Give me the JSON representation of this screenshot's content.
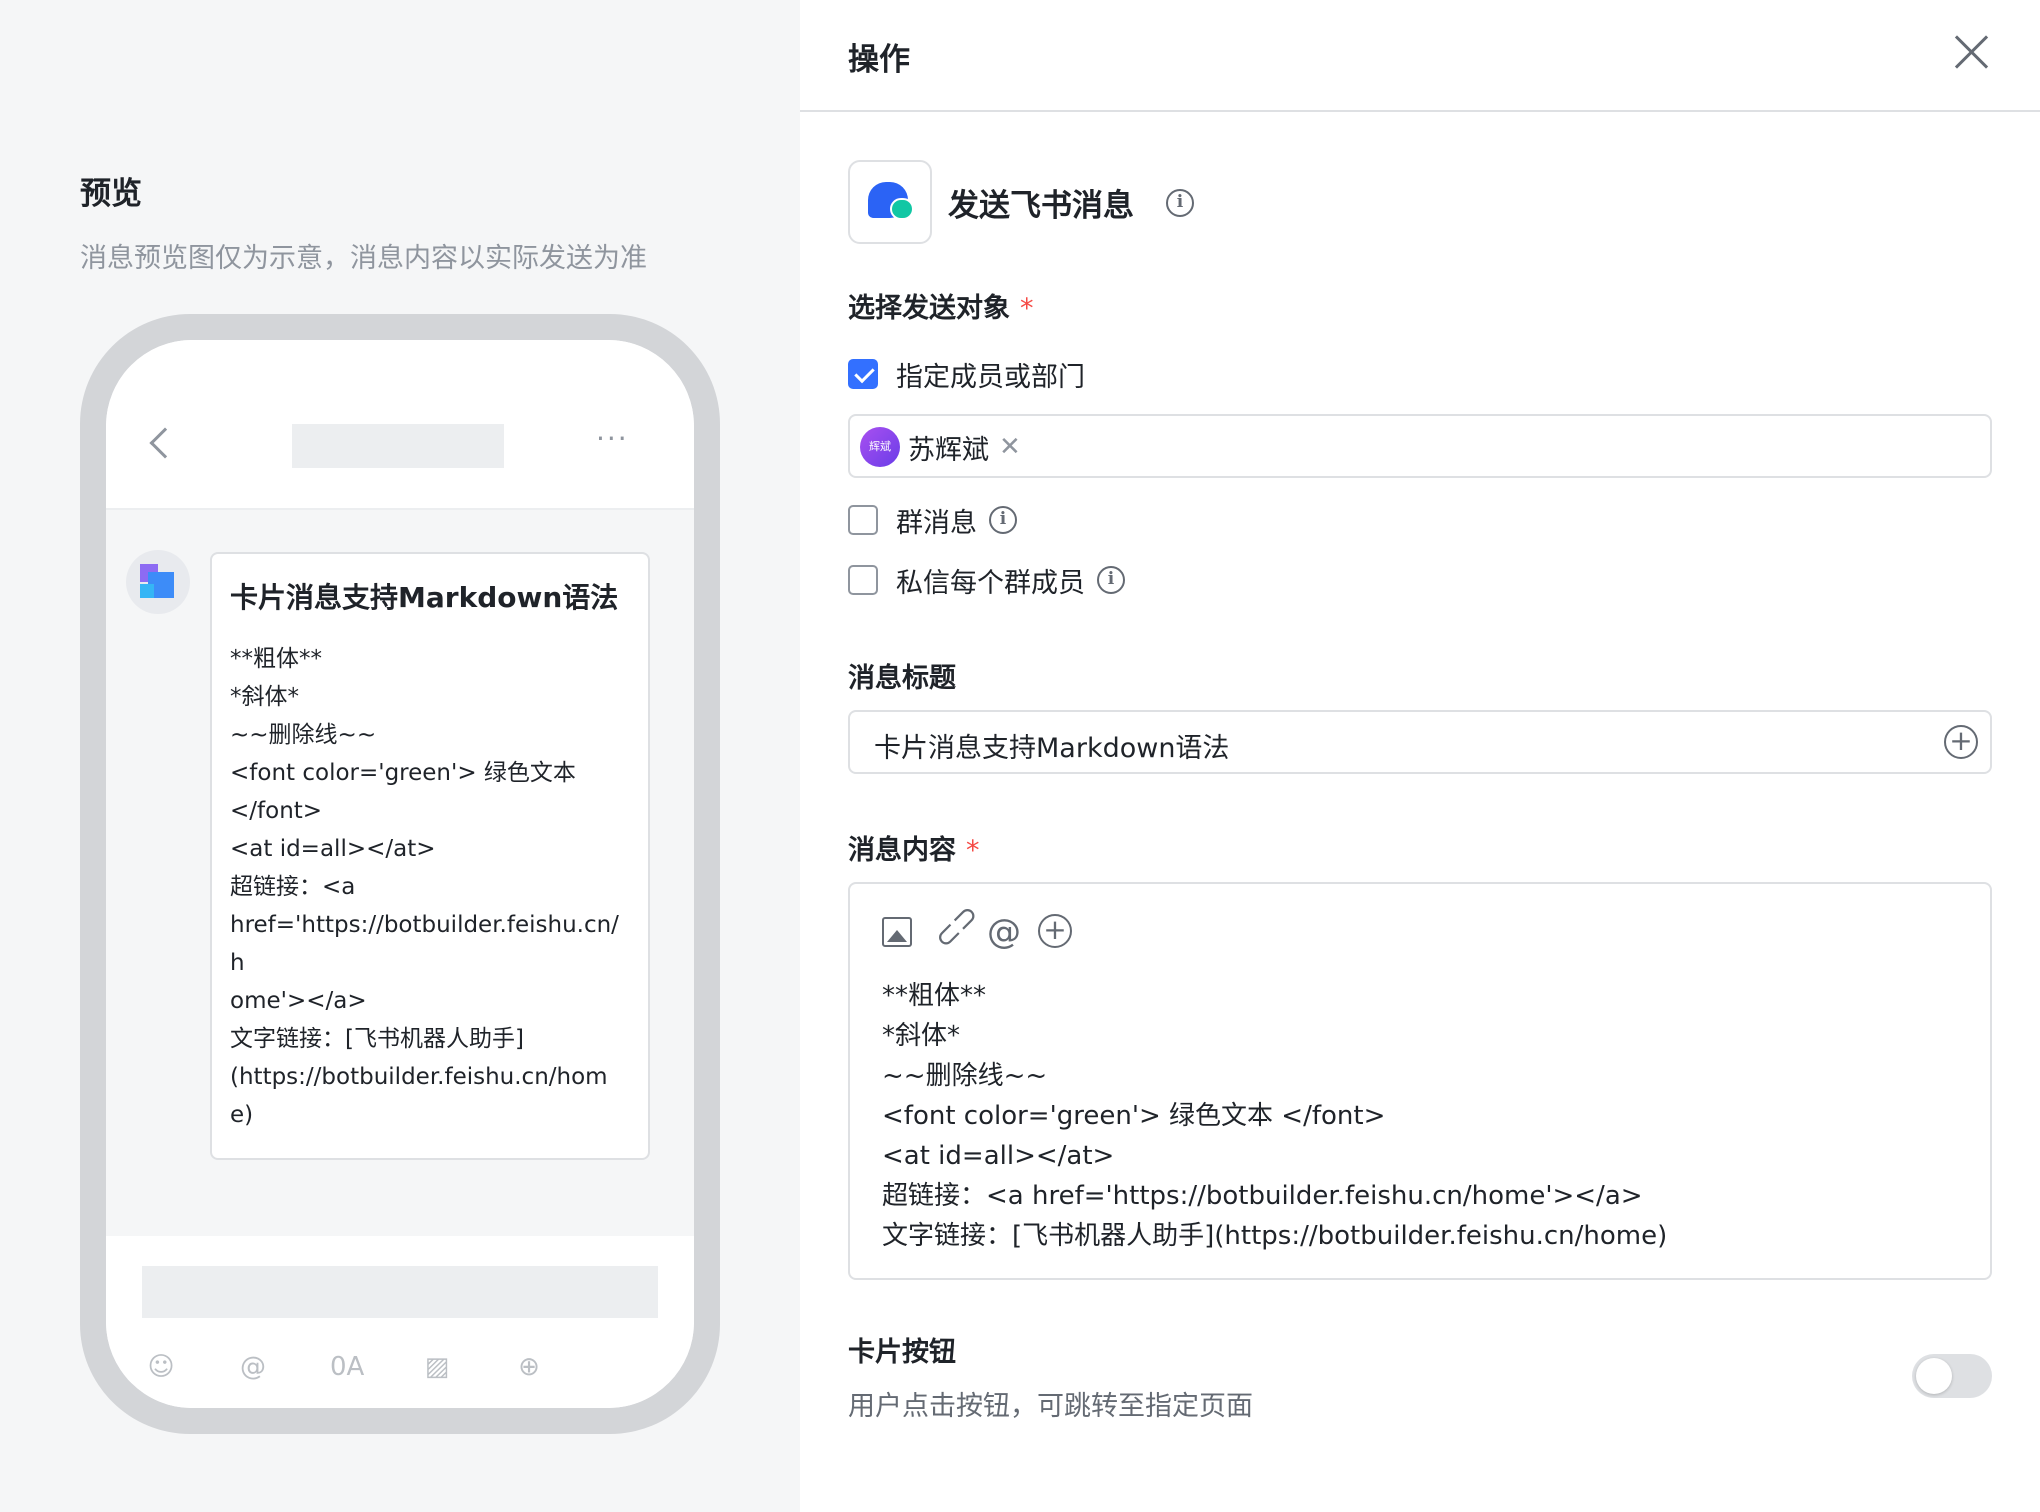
{
  "preview": {
    "title": "预览",
    "subtitle": "消息预览图仅为示意，消息内容以实际发送为准",
    "more_dots": "···",
    "card": {
      "title": "卡片消息支持Markdown语法",
      "lines": [
        "**粗体**",
        "*斜体*",
        "~~删除线~~",
        "<font color='green'> 绿色文本",
        "</font>",
        "<at id=all></at>",
        "超链接：<a",
        "href='https://botbuilder.feishu.cn/h",
        "ome'></a>",
        "文字链接：[飞书机器人助手]",
        "(https://botbuilder.feishu.cn/home)"
      ]
    },
    "footer_tools": [
      "smile-icon",
      "at-icon",
      "font-icon",
      "image-icon",
      "plus-icon"
    ],
    "footer_tool_glyphs": [
      "☺",
      "@",
      "0A",
      "▨",
      "⊕"
    ]
  },
  "ops": {
    "header_title": "操作",
    "action": {
      "name": "发送飞书消息",
      "info_glyph": "i",
      "colors": {
        "bubble_blue": "#2b63f5",
        "bubble_green": "#11c7a4"
      }
    },
    "recipient": {
      "label": "选择发送对象",
      "required_mark": "*",
      "options": [
        {
          "label": "指定成员或部门",
          "checked": true
        },
        {
          "label": "群消息",
          "checked": false
        },
        {
          "label": "私信每个群成员",
          "checked": false
        }
      ],
      "selected_member": {
        "avatar_text": "辉斌",
        "name": "苏辉斌",
        "remove_glyph": "✕"
      }
    },
    "message_title": {
      "label": "消息标题",
      "value": "卡片消息支持Markdown语法",
      "insert_glyph": "+"
    },
    "message_content": {
      "label": "消息内容",
      "required_mark": "*",
      "toolbar": [
        "image-icon",
        "link-icon",
        "at-icon",
        "plus-icon"
      ],
      "toolbar_glyphs": {
        "link": "⊂⊃",
        "at": "@",
        "plus": "+"
      },
      "lines": [
        "**粗体**",
        "*斜体*",
        "~~删除线~~",
        "<font color='green'> 绿色文本 </font>",
        "<at id=all></at>",
        "超链接：<a href='https://botbuilder.feishu.cn/home'></a>",
        "文字链接：[飞书机器人助手](https://botbuilder.feishu.cn/home)"
      ]
    },
    "card_button": {
      "label": "卡片按钮",
      "description": "用户点击按钮，可跳转至指定页面",
      "enabled": false
    },
    "accent_color": "#3370ff",
    "required_color": "#f54a45"
  }
}
